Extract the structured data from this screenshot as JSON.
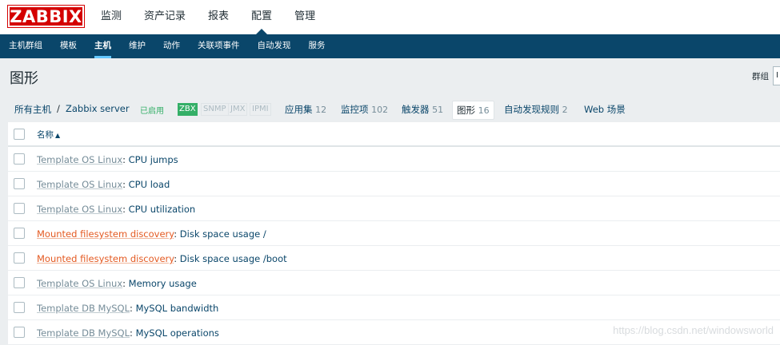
{
  "header": {
    "logo": "ZABBIX",
    "menu": [
      {
        "label": "监测",
        "active": false
      },
      {
        "label": "资产记录",
        "active": false
      },
      {
        "label": "报表",
        "active": false
      },
      {
        "label": "配置",
        "active": true
      },
      {
        "label": "管理",
        "active": false
      }
    ]
  },
  "submenu": [
    {
      "label": "主机群组",
      "active": false
    },
    {
      "label": "模板",
      "active": false
    },
    {
      "label": "主机",
      "active": true
    },
    {
      "label": "维护",
      "active": false
    },
    {
      "label": "动作",
      "active": false
    },
    {
      "label": "关联项事件",
      "active": false
    },
    {
      "label": "自动发现",
      "active": false
    },
    {
      "label": "服务",
      "active": false
    }
  ],
  "page": {
    "title": "图形",
    "group_label": "群组",
    "group_value": "I"
  },
  "hostnav": {
    "all_hosts": "所有主机",
    "separator": "/",
    "host": "Zabbix server",
    "status": "已启用",
    "badges": [
      {
        "label": "ZBX",
        "on": true
      },
      {
        "label": "SNMP",
        "on": false
      },
      {
        "label": "JMX",
        "on": false
      },
      {
        "label": "IPMI",
        "on": false
      }
    ],
    "applications": {
      "label": "应用集",
      "count": "12"
    },
    "items": {
      "label": "监控项",
      "count": "102"
    },
    "triggers": {
      "label": "触发器",
      "count": "51"
    },
    "graphs": {
      "label": "图形",
      "count": "16"
    },
    "discovery": {
      "label": "自动发现规则",
      "count": "2"
    },
    "web": {
      "label": "Web 场景"
    }
  },
  "table": {
    "header": {
      "name": "名称"
    },
    "rows": [
      {
        "prefix": "Template OS Linux",
        "type": "template",
        "name": "CPU jumps"
      },
      {
        "prefix": "Template OS Linux",
        "type": "template",
        "name": "CPU load"
      },
      {
        "prefix": "Template OS Linux",
        "type": "template",
        "name": "CPU utilization"
      },
      {
        "prefix": "Mounted filesystem discovery",
        "type": "discovery",
        "name": "Disk space usage /"
      },
      {
        "prefix": "Mounted filesystem discovery",
        "type": "discovery",
        "name": "Disk space usage /boot"
      },
      {
        "prefix": "Template OS Linux",
        "type": "template",
        "name": "Memory usage"
      },
      {
        "prefix": "Template DB MySQL",
        "type": "template",
        "name": "MySQL bandwidth"
      },
      {
        "prefix": "Template DB MySQL",
        "type": "template",
        "name": "MySQL operations"
      }
    ]
  },
  "watermark": "https://blog.csdn.net/windowsworld"
}
